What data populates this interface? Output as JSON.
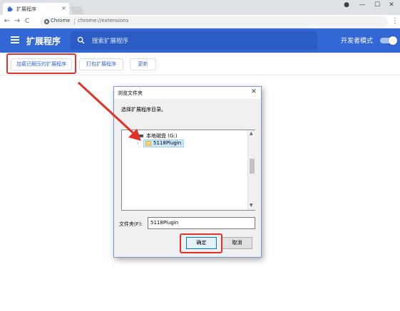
{
  "colors": {
    "header_blue": "#3367d6",
    "highlight_red": "#e0322b",
    "dialog_border": "#7a9ccd"
  },
  "browser": {
    "tab": {
      "title": "扩展程序",
      "favicon": "puzzle-icon",
      "close": "×"
    },
    "window": {
      "account": "●",
      "minimize": "—",
      "maximize": "☐",
      "close": "✕"
    },
    "nav": {
      "back": "←",
      "forward": "→",
      "reload": "C"
    },
    "omnibox": {
      "chip": "Chrome",
      "url": "chrome://extensions"
    },
    "menu": "⋮"
  },
  "extensions": {
    "title": "扩展程序",
    "search_placeholder": "搜索扩展程序",
    "developer_mode_label": "开发者模式",
    "developer_mode_on": true,
    "actions": {
      "load_unpacked": "加载已解压的扩展程序",
      "pack": "打包扩展程序",
      "update": "更新"
    }
  },
  "dialog": {
    "title": "浏览文件夹",
    "close": "✕",
    "prompt": "选择扩展程序目录。",
    "tree": {
      "drive": "本地磁盘 (G:)",
      "folder": "5118Plugin"
    },
    "scroll_up": "▲",
    "scroll_down": "▼",
    "folder_label": "文件夹(F):",
    "folder_value": "5118Plugin",
    "ok": "确定",
    "cancel": "取消"
  }
}
